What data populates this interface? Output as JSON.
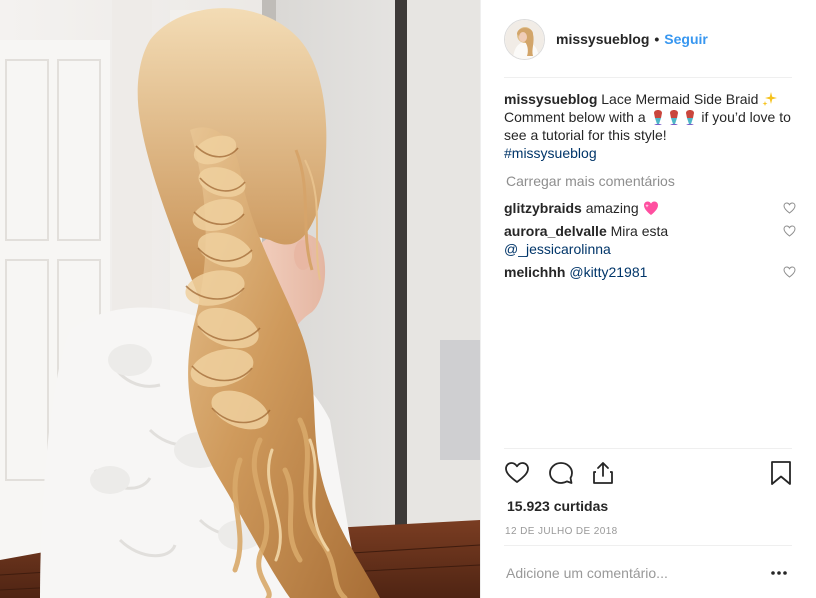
{
  "post": {
    "username": "missysueblog",
    "dot": "•",
    "follow_label": "Seguir",
    "caption": {
      "username": "missysueblog",
      "text_1": "Lace Mermaid Side Braid",
      "emoji_1": "sparkles-emoji",
      "text_2": "Comment below with a",
      "emoji_2": "mermaid-emoji",
      "text_3": "if you’d love to see a tutorial for this style!",
      "hashtag": "#missysueblog"
    },
    "load_more_label": "Carregar mais comentários",
    "comments": [
      {
        "username": "glitzybraids",
        "text": "amazing",
        "emoji": "sparkling-heart-emoji"
      },
      {
        "username": "aurora_delvalle",
        "text": "Mira esta",
        "mention": "@_jessicarolinna"
      },
      {
        "username": "melichhh",
        "mention": "@kitty21981"
      }
    ],
    "likes": "15.923 curtidas",
    "date": "12 DE JULHO DE 2018",
    "add_comment_placeholder": "Adicione um comentário...",
    "icons": {
      "like": "heart-icon",
      "comment": "comment-icon",
      "share": "share-icon",
      "save": "bookmark-icon",
      "more": "more-options-icon"
    },
    "colors": {
      "link_blue": "#3897f0",
      "hashtag_blue": "#003569",
      "muted_grey": "#8e8e8e",
      "emoji_heart": "#ff4fa0"
    }
  }
}
